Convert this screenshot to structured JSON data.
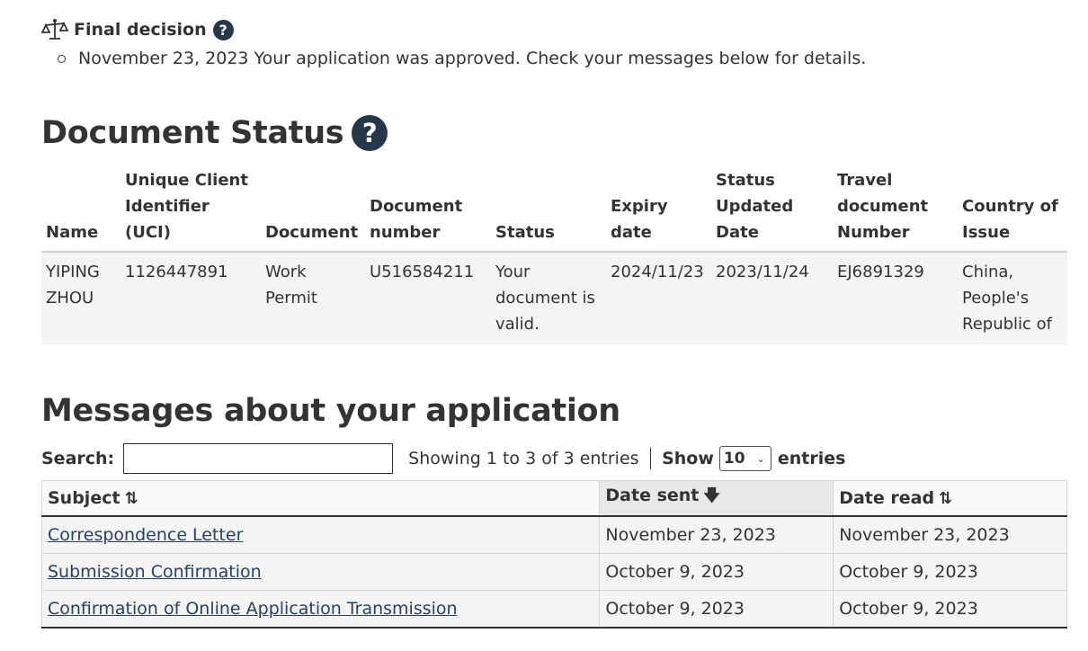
{
  "final_decision": {
    "icon": "balance-scale-icon",
    "title": "Final decision",
    "help": "?",
    "items": [
      "November 23, 2023 Your application was approved. Check your messages below for details."
    ]
  },
  "document_status": {
    "title": "Document Status",
    "help": "?",
    "headers": {
      "name": "Name",
      "uci": "Unique Client Identifier (UCI)",
      "document": "Document",
      "document_number": "Document number",
      "status": "Status",
      "expiry": "Expiry date",
      "status_updated": "Status Updated Date",
      "travel_doc": "Travel document Number",
      "country": "Country of Issue"
    },
    "rows": [
      {
        "name": "YIPING ZHOU",
        "uci": "1126447891",
        "document": "Work Permit",
        "document_number": "U516584211",
        "status": "Your document is valid.",
        "expiry": "2024/11/23",
        "status_updated": "2023/11/24",
        "travel_doc": "EJ6891329",
        "country": "China, People's Republic of"
      }
    ]
  },
  "messages": {
    "title": "Messages about your application",
    "search_label": "Search:",
    "search_value": "",
    "info": "Showing 1 to 3 of 3 entries",
    "show_label": "Show",
    "page_length": "10",
    "entries_label": "entries",
    "columns": {
      "subject": "Subject",
      "date_sent": "Date sent",
      "date_read": "Date read"
    },
    "sort_icons": {
      "subject": "⇅",
      "date_sent": "🡇",
      "date_read": "⇅"
    },
    "rows": [
      {
        "subject": "Correspondence Letter",
        "date_sent": "November 23, 2023",
        "date_read": "November 23, 2023"
      },
      {
        "subject": "Submission Confirmation",
        "date_sent": "October 9, 2023",
        "date_read": "October 9, 2023"
      },
      {
        "subject": "Confirmation of Online Application Transmission",
        "date_sent": "October 9, 2023",
        "date_read": "October 9, 2023"
      }
    ]
  }
}
